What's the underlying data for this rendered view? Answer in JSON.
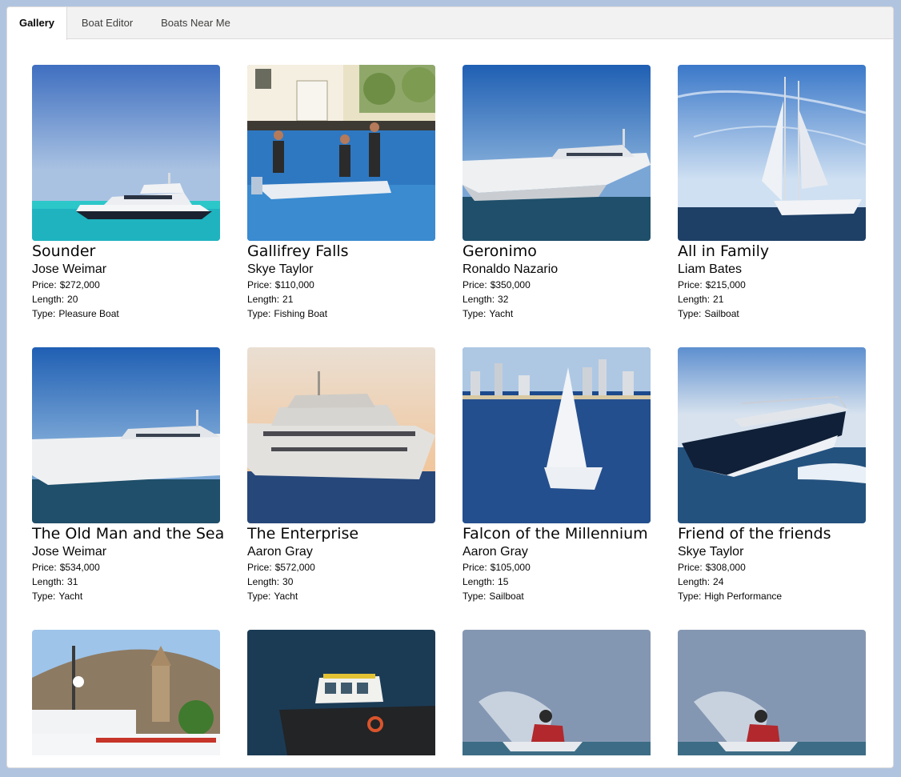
{
  "tabs": [
    {
      "label": "Gallery",
      "active": true
    },
    {
      "label": "Boat Editor",
      "active": false
    },
    {
      "label": "Boats Near Me",
      "active": false
    }
  ],
  "field_labels": {
    "price": "Price:",
    "length": "Length:",
    "type": "Type:"
  },
  "boats": [
    {
      "name": "Sounder",
      "owner": "Jose Weimar",
      "price": "$272,000",
      "length": "20",
      "type": "Pleasure Boat",
      "photo": "motor-yacht-turquoise-sea"
    },
    {
      "name": "Gallifrey Falls",
      "owner": "Skye Taylor",
      "price": "$110,000",
      "length": "21",
      "type": "Fishing Boat",
      "photo": "fishermen-on-boat-by-dock"
    },
    {
      "name": "Geronimo",
      "owner": "Ronaldo Nazario",
      "price": "$350,000",
      "length": "32",
      "type": "Yacht",
      "photo": "white-yacht-blue-sky"
    },
    {
      "name": "All in Family",
      "owner": "Liam Bates",
      "price": "$215,000",
      "length": "21",
      "type": "Sailboat",
      "photo": "sailboat-cloudy-sky"
    },
    {
      "name": "The Old Man and the Sea",
      "owner": "Jose Weimar",
      "price": "$534,000",
      "length": "31",
      "type": "Yacht",
      "photo": "white-yacht-blue-sky"
    },
    {
      "name": "The Enterprise",
      "owner": "Aaron Gray",
      "price": "$572,000",
      "length": "30",
      "type": "Yacht",
      "photo": "yacht-sunset"
    },
    {
      "name": "Falcon of the Millennium",
      "owner": "Aaron Gray",
      "price": "$105,000",
      "length": "15",
      "type": "Sailboat",
      "photo": "sailboat-city-skyline"
    },
    {
      "name": "Friend of the friends",
      "owner": "Skye Taylor",
      "price": "$308,000",
      "length": "24",
      "type": "High Performance",
      "photo": "speedboat-spray"
    },
    {
      "photo": "superyacht-harbor-town"
    },
    {
      "photo": "tugboat-dark-water"
    },
    {
      "photo": "jet-ski-spray"
    },
    {
      "photo": "jet-ski-spray"
    }
  ]
}
